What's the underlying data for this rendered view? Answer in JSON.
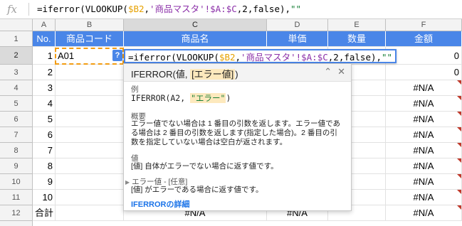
{
  "formula_bar": {
    "icon": "fx-icon",
    "prefix": "=iferror(VLOOKUP(",
    "ref": "$B2",
    "comma1": ",",
    "range": "'商品マスタ'!$A:$C",
    "rest": ",2,false),",
    "string": "\"\""
  },
  "columns": [
    "A",
    "B",
    "C",
    "D",
    "E",
    "F"
  ],
  "rows": [
    "1",
    "2",
    "3",
    "4",
    "5",
    "6",
    "7",
    "8",
    "9",
    "10",
    "11",
    "12"
  ],
  "header_row": [
    "No.",
    "商品コード",
    "商品名",
    "単価",
    "数量",
    "金額"
  ],
  "col_a": [
    "1",
    "2",
    "3",
    "4",
    "5",
    "6",
    "7",
    "8",
    "9",
    "10",
    "合計"
  ],
  "b2_value": "A01",
  "help_badge": "?",
  "col_f": [
    "0",
    "0",
    "#N/A",
    "#N/A",
    "#N/A",
    "#N/A",
    "#N/A",
    "#N/A",
    "#N/A",
    "#N/A",
    "#N/A"
  ],
  "c12": "#N/A",
  "d12": "#N/A",
  "editor": {
    "prefix": "=iferror(VLOOKUP(",
    "ref": "$B2",
    "comma1": ",",
    "range": "'商品マスタ'!$A:$C",
    "rest": ",2,false),",
    "string": "\"\""
  },
  "popup": {
    "fn": "IFERROR(値, ",
    "arg": "[エラー値]",
    "close_paren": ")",
    "collapse": "⌃",
    "close": "✕",
    "example_label": "例",
    "example_fn": "IFERROR(A2, ",
    "example_str": "\"エラー\"",
    "example_close": ")",
    "summary_label": "概要",
    "summary": "エラー値でない場合は 1 番目の引数を返します。エラー値である場合は 2 番目の引数を返します(指定した場合)。2 番目の引数を指定していない場合は空白が返されます。",
    "value_label": "値",
    "value_desc": "[値] 自体がエラーでない場合に返す値です。",
    "err_label": "エラー値 - [任意]",
    "err_desc": "[値] がエラーである場合に返す値です。",
    "link": "IFERRORの詳細"
  },
  "colors": {
    "header_blue": "#4a86e8",
    "editor_border": "#4a86e8",
    "ref_highlight": "#f39c12",
    "error_marker": "#c0392b"
  }
}
